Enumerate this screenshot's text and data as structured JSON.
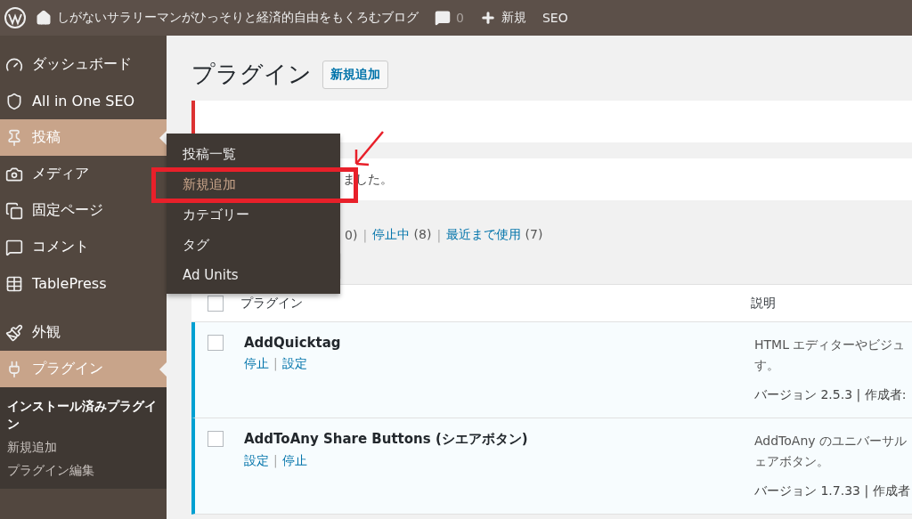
{
  "admin_bar": {
    "site_title": "しがないサラリーマンがひっそりと経済的自由をもくろむブログ",
    "comments": "0",
    "new_label": "新規",
    "seo_label": "SEO"
  },
  "sidebar": {
    "items": [
      {
        "label": "ダッシュボード",
        "selected": false
      },
      {
        "label": "All in One SEO",
        "selected": false
      },
      {
        "label": "投稿",
        "selected": true
      },
      {
        "label": "メディア",
        "selected": false
      },
      {
        "label": "固定ページ",
        "selected": false
      },
      {
        "label": "コメント",
        "selected": false
      },
      {
        "label": "TablePress",
        "selected": false
      },
      {
        "label": "外観",
        "selected": false
      },
      {
        "label": "プラグイン",
        "selected": true,
        "children": [
          {
            "label": "インストール済みプラグイン",
            "selected": true
          },
          {
            "label": "新規追加",
            "selected": false
          },
          {
            "label": "プラグイン編集",
            "selected": false
          }
        ]
      }
    ]
  },
  "flyout": {
    "items": [
      {
        "label": "投稿一覧",
        "selected": false
      },
      {
        "label": "新規追加",
        "selected": true
      },
      {
        "label": "カテゴリー",
        "selected": false
      },
      {
        "label": "タグ",
        "selected": false
      },
      {
        "label": "Ad Units",
        "selected": false
      }
    ]
  },
  "page": {
    "title": "プラグイン",
    "add_new_button": "新規追加",
    "notice": "ました。",
    "filters": [
      {
        "kind": "text",
        "label": "0)"
      },
      {
        "kind": "separator",
        "label": "|"
      },
      {
        "kind": "link",
        "label": "停止中",
        "count": "(8)"
      },
      {
        "kind": "separator",
        "label": "|"
      },
      {
        "kind": "link",
        "label": "最近まで使用",
        "count": "(7)"
      }
    ],
    "table": {
      "columns": [
        "プラグイン",
        "説明"
      ],
      "select_all_checked": false,
      "rows": [
        {
          "name": "AddQuicktag",
          "checked": false,
          "actions": [
            {
              "kind": "link",
              "label": "停止"
            },
            {
              "kind": "separator",
              "label": "|"
            },
            {
              "kind": "link",
              "label": "設定"
            }
          ],
          "description": [
            "HTML エディターやビジュ",
            "す。"
          ],
          "meta": "バージョン 2.5.3 | 作成者:",
          "active": true
        },
        {
          "name": "AddToAny Share Buttons (シエアボタン)",
          "checked": false,
          "actions": [
            {
              "kind": "link",
              "label": "設定"
            },
            {
              "kind": "separator",
              "label": "|"
            },
            {
              "kind": "link",
              "label": "停止"
            }
          ],
          "description": [
            "AddToAny のユニバーサル",
            "ェアボタン。"
          ],
          "meta": "バージョン 1.7.33 | 作成者",
          "active": true
        }
      ]
    }
  }
}
